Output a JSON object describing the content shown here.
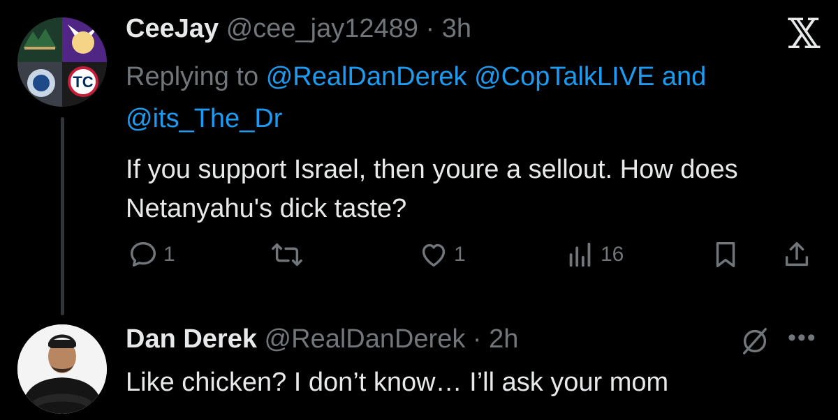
{
  "tweet": {
    "author_name": "CeeJay",
    "author_handle": "@cee_jay12489",
    "time": "· 3h",
    "replying_prefix": "Replying to",
    "mention_1": "@RealDanDerek",
    "mention_2": "@CopTalkLIVE",
    "mention_and": "and",
    "mention_3": "@its_The_Dr",
    "text": "If you support Israel, then youre a sellout. How does Netanyahu's dick taste?",
    "reply_count": "1",
    "like_count": "1",
    "view_count": "16"
  },
  "reply": {
    "author_name": "Dan Derek",
    "author_handle": "@RealDanDerek",
    "time": "· 2h",
    "text": "Like chicken? I don’t know… I’ll ask your mom"
  },
  "icons": {
    "x_logo": "x-logo-icon",
    "reply": "reply-icon",
    "retweet": "retweet-icon",
    "like": "heart-icon",
    "views": "views-icon",
    "bookmark": "bookmark-icon",
    "share": "share-icon",
    "muted": "muted-icon",
    "more": "more-icon"
  },
  "colors": {
    "background": "#000000",
    "text": "#e7e9ea",
    "muted": "#71767b",
    "link": "#1d9bf0"
  }
}
